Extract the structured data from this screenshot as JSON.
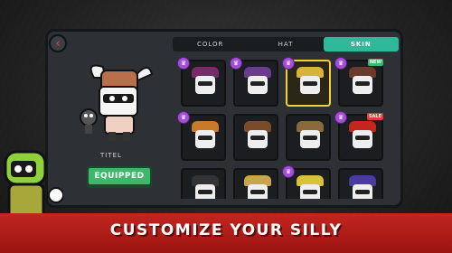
{
  "ui": {
    "back_icon": "chevron-left-icon",
    "character_name": "TITEL",
    "equipped_label": "EQUIPPED"
  },
  "tabs": [
    {
      "label": "COLOR",
      "active": false
    },
    {
      "label": "HAT",
      "active": false
    },
    {
      "label": "SKIN",
      "active": true
    }
  ],
  "items": [
    {
      "badge": "crown",
      "tag": "",
      "selected": false,
      "hat_color": "#7a2a6b"
    },
    {
      "badge": "crown",
      "tag": "",
      "selected": false,
      "hat_color": "#6a3b8f"
    },
    {
      "badge": "crown",
      "tag": "",
      "selected": true,
      "hat_color": "#d9b23b"
    },
    {
      "badge": "crown",
      "tag": "NEW",
      "selected": false,
      "hat_color": "#6a3b2b"
    },
    {
      "badge": "crown",
      "tag": "",
      "selected": false,
      "hat_color": "#c77a2b"
    },
    {
      "badge": "",
      "tag": "",
      "selected": false,
      "hat_color": "#7a4b2b"
    },
    {
      "badge": "",
      "tag": "",
      "selected": false,
      "hat_color": "#8a6a3b"
    },
    {
      "badge": "crown",
      "tag": "SALE",
      "selected": false,
      "hat_color": "#c2261f"
    },
    {
      "badge": "",
      "tag": "",
      "selected": false,
      "hat_color": "#333"
    },
    {
      "badge": "",
      "tag": "",
      "selected": false,
      "hat_color": "#c9a44a"
    },
    {
      "badge": "crown",
      "tag": "",
      "selected": false,
      "hat_color": "#d9c23b"
    },
    {
      "badge": "",
      "tag": "",
      "selected": false,
      "hat_color": "#4b3aa6"
    }
  ],
  "banner": {
    "text": "CUSTOMIZE YOUR SILLY"
  },
  "colors": {
    "panel": "#2d3136",
    "accent": "#2fb99b",
    "equipped": "#3db86a",
    "banner": "#c2261f"
  }
}
